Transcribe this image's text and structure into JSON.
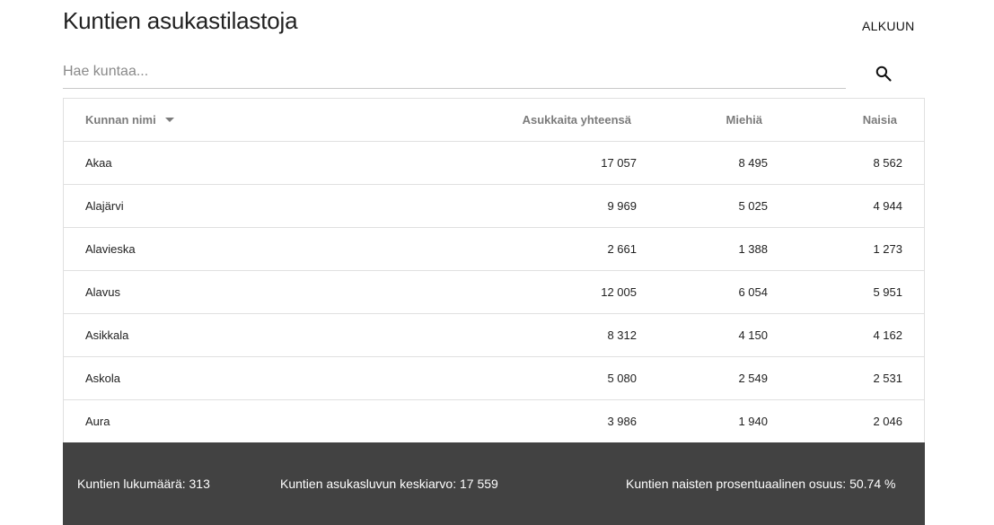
{
  "header": {
    "title": "Kuntien asukastilastoja",
    "nav_label": "ALKUUN"
  },
  "search": {
    "placeholder": "Hae kuntaa..."
  },
  "table": {
    "columns": [
      "Kunnan nimi",
      "Asukkaita yhteensä",
      "Miehiä",
      "Naisia"
    ],
    "sort_column": "Kunnan nimi",
    "rows": [
      {
        "name": "Akaa",
        "total": "17 057",
        "men": "8 495",
        "women": "8 562"
      },
      {
        "name": "Alajärvi",
        "total": "9 969",
        "men": "5 025",
        "women": "4 944"
      },
      {
        "name": "Alavieska",
        "total": "2 661",
        "men": "1 388",
        "women": "1 273"
      },
      {
        "name": "Alavus",
        "total": "12 005",
        "men": "6 054",
        "women": "5 951"
      },
      {
        "name": "Asikkala",
        "total": "8 312",
        "men": "4 150",
        "women": "4 162"
      },
      {
        "name": "Askola",
        "total": "5 080",
        "men": "2 549",
        "women": "2 531"
      },
      {
        "name": "Aura",
        "total": "3 986",
        "men": "1 940",
        "women": "2 046"
      }
    ]
  },
  "footer": {
    "count_text": "Kuntien lukumäärä: 313",
    "avg_text": "Kuntien asukasluvun keskiarvo: 17 559",
    "women_share_text": "Kuntien naisten prosentuaalinen osuus: 50.74 %"
  },
  "colors": {
    "footer_bg": "#424242",
    "header_text": "#7b7b7b"
  },
  "icons": {
    "search": "search-icon",
    "sort": "sort-desc-icon"
  }
}
